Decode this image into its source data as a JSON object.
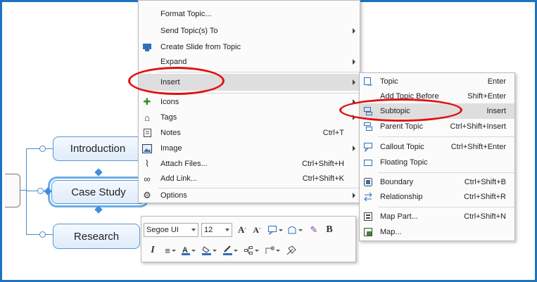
{
  "mindmap": {
    "topics": [
      "Introduction",
      "Case Study",
      "Research"
    ]
  },
  "context_menu": {
    "items": [
      {
        "label": "Format Topic...",
        "shortcut": "",
        "icon": "none",
        "submenu": false
      },
      {
        "label": "Send Topic(s) To",
        "shortcut": "",
        "icon": "none",
        "submenu": true
      },
      {
        "label": "Create Slide from Topic",
        "shortcut": "",
        "icon": "slide-icon",
        "submenu": false
      },
      {
        "label": "Expand",
        "shortcut": "",
        "icon": "none",
        "submenu": true
      },
      {
        "label": "Insert",
        "shortcut": "",
        "icon": "none",
        "submenu": true
      },
      {
        "label": "Icons",
        "shortcut": "",
        "icon": "icons-icon",
        "submenu": true
      },
      {
        "label": "Tags",
        "shortcut": "",
        "icon": "tag-icon",
        "submenu": true
      },
      {
        "label": "Notes",
        "shortcut": "Ctrl+T",
        "icon": "notes-icon",
        "submenu": false
      },
      {
        "label": "Image",
        "shortcut": "",
        "icon": "image-icon",
        "submenu": true
      },
      {
        "label": "Attach Files...",
        "shortcut": "Ctrl+Shift+H",
        "icon": "paperclip-icon",
        "submenu": false
      },
      {
        "label": "Add Link...",
        "shortcut": "Ctrl+Shift+K",
        "icon": "link-icon",
        "submenu": false
      },
      {
        "label": "Options",
        "shortcut": "",
        "icon": "gear-icon",
        "submenu": true
      }
    ]
  },
  "insert_submenu": {
    "items": [
      {
        "label": "Topic",
        "shortcut": "Enter",
        "icon": "topic-icon"
      },
      {
        "label": "Add Topic Before",
        "shortcut": "Shift+Enter",
        "icon": "none"
      },
      {
        "label": "Subtopic",
        "shortcut": "Insert",
        "icon": "subtopic-icon"
      },
      {
        "label": "Parent Topic",
        "shortcut": "Ctrl+Shift+Insert",
        "icon": "parent-topic-icon"
      },
      {
        "label": "Callout Topic",
        "shortcut": "Ctrl+Shift+Enter",
        "icon": "callout-icon"
      },
      {
        "label": "Floating Topic",
        "shortcut": "",
        "icon": "floating-topic-icon"
      },
      {
        "label": "Boundary",
        "shortcut": "Ctrl+Shift+B",
        "icon": "boundary-icon"
      },
      {
        "label": "Relationship",
        "shortcut": "Ctrl+Shift+R",
        "icon": "relationship-icon"
      },
      {
        "label": "Map Part...",
        "shortcut": "Ctrl+Shift+N",
        "icon": "map-part-icon"
      },
      {
        "label": "Map...",
        "shortcut": "",
        "icon": "map-icon"
      }
    ]
  },
  "mini_toolbar": {
    "font": "Segoe UI",
    "size": "12",
    "bold": "B",
    "italic": "I"
  },
  "colors": {
    "frame": "#1e73be",
    "highlight_ring": "#e01010",
    "topic_border": "#5b95cf"
  }
}
